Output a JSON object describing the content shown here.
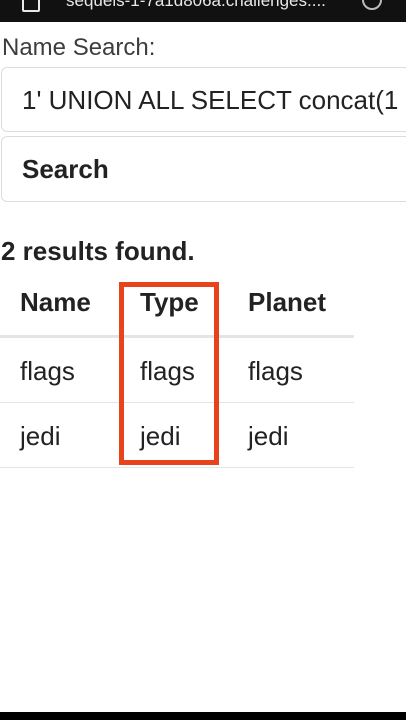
{
  "browser": {
    "url": "sequels-1-7a1d806a.challenges...."
  },
  "form": {
    "label": "Name Search:",
    "input_value": "1' UNION ALL SELECT concat(1",
    "search_label": "Search"
  },
  "results": {
    "summary": "2 results found.",
    "columns": [
      "Name",
      "Type",
      "Planet"
    ],
    "rows": [
      [
        "flags",
        "flags",
        "flags"
      ],
      [
        "jedi",
        "jedi",
        "jedi"
      ]
    ]
  },
  "colors": {
    "highlight": "#e8441c"
  }
}
